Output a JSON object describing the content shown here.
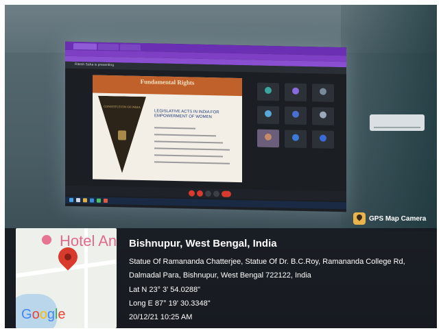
{
  "screen": {
    "presenter_banner": "Ritesh Saha is presenting",
    "slide": {
      "title": "Fundamental Rights",
      "pennant_text": "CONSTITUTION OF INDIA",
      "heading": "LEGISLATIVE ACTS IN INDIA FOR EMPOWERMENT OF WOMEN"
    }
  },
  "gps_camera": {
    "label": "GPS Map Camera"
  },
  "map": {
    "place_label": "Hotel Ann",
    "logo": "Google"
  },
  "location": {
    "title": "Bishnupur, West Bengal, India",
    "address_line1": "Statue Of Ramananda Chatterjee, Statue Of Dr. B.C.Roy, Ramananda College Rd,",
    "address_line2": "Dalmadal Para, Bishnupur, West Bengal 722122, India",
    "lat": "Lat N 23° 3' 54.0288\"",
    "long": "Long E 87° 19' 30.3348\"",
    "datetime": "20/12/21 10:25 AM"
  },
  "colors": {
    "browser_accent": "#7e3fc4",
    "slide_header": "#c0612b",
    "pin": "#d93a2e"
  }
}
